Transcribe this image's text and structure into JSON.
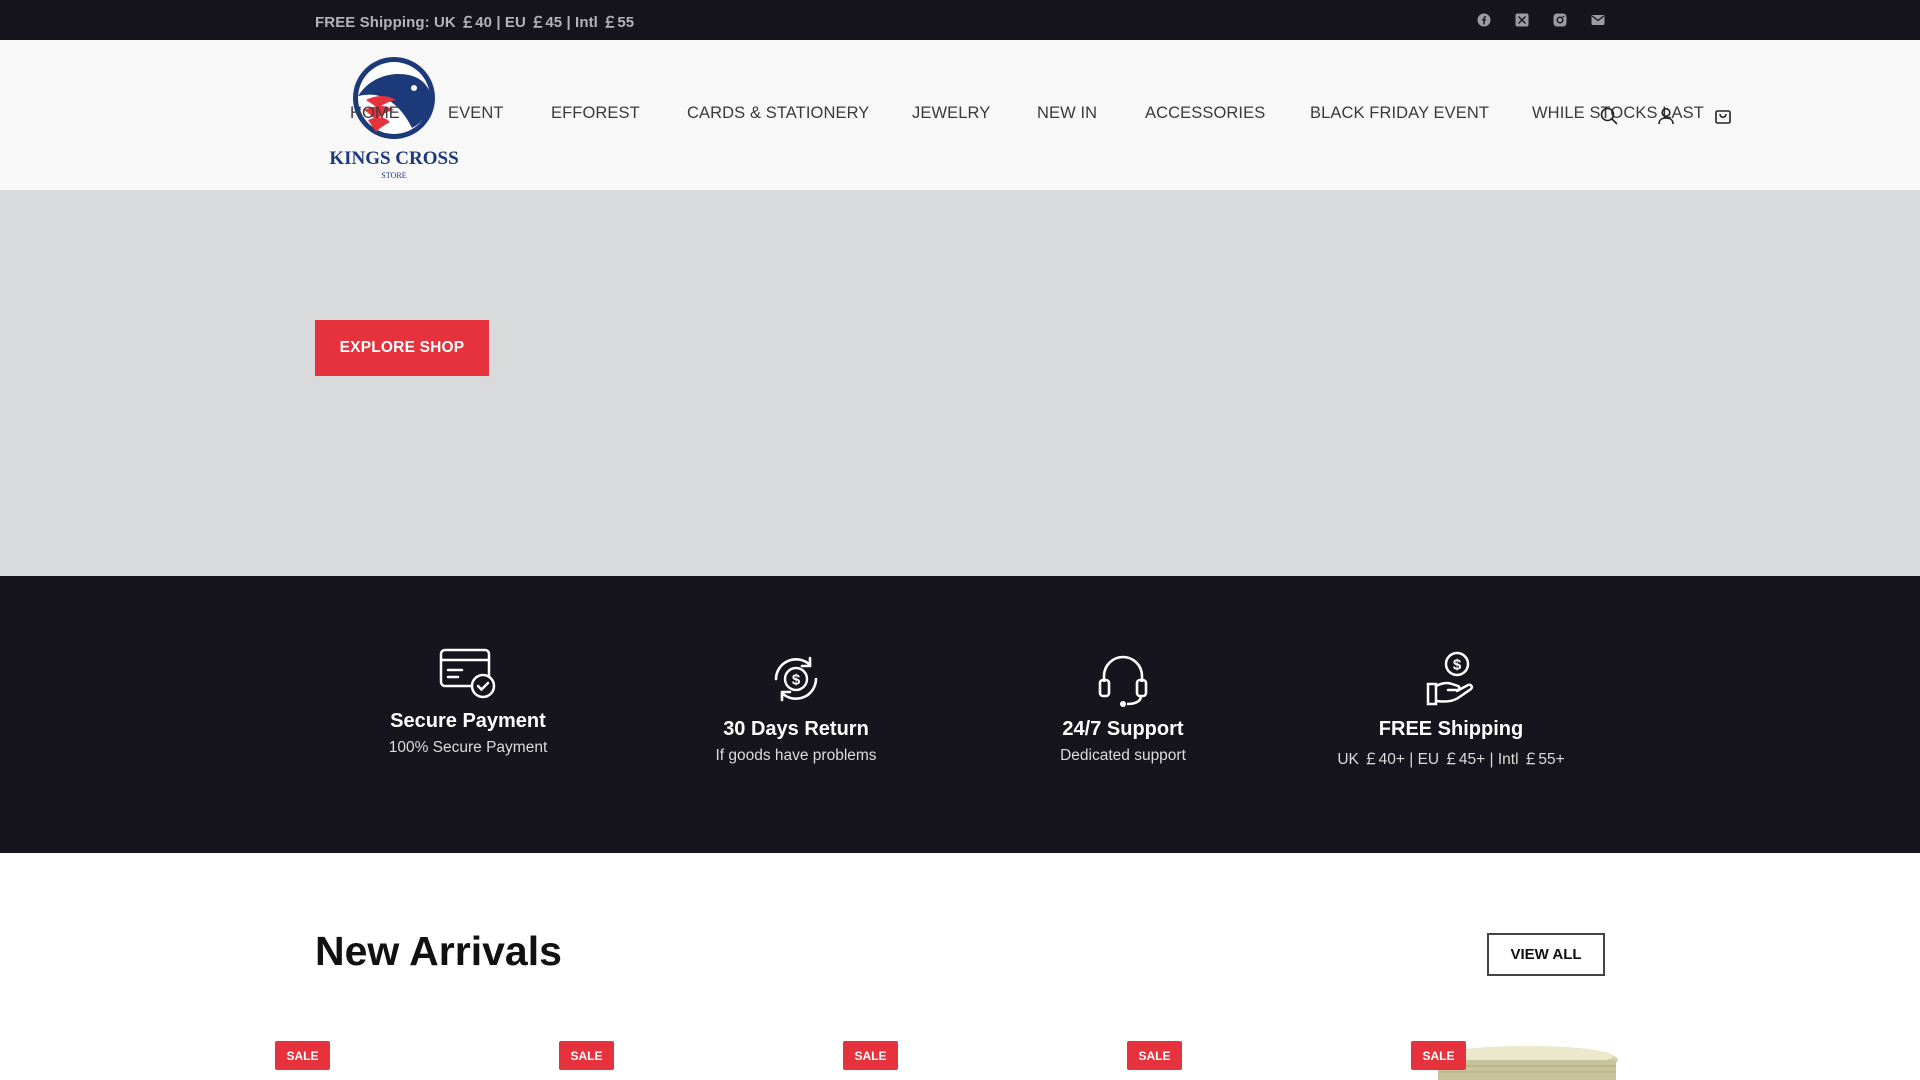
{
  "topbar": {
    "shipping_text": "FREE Shipping: UK ￡40 | EU ￡45 | Intl ￡55",
    "social_icons": [
      "facebook-icon",
      "x-icon",
      "instagram-icon",
      "email-icon"
    ]
  },
  "header": {
    "logo": {
      "name": "KINGS CROSS",
      "sub": "STORE"
    },
    "nav": [
      "HOME",
      "EVENT",
      "EFFOREST",
      "CARDS & STATIONERY",
      "JEWELRY",
      "NEW IN",
      "ACCESSORIES",
      "BLACK FRIDAY EVENT",
      "WHILE STOCKS LAST"
    ],
    "icons": [
      "search-icon",
      "user-icon",
      "cart-icon"
    ]
  },
  "hero": {
    "cta_label": "EXPLORE SHOP"
  },
  "features": [
    {
      "icon": "secure-payment-icon",
      "title": "Secure Payment",
      "subtitle": "100% Secure Payment"
    },
    {
      "icon": "return-icon",
      "title": "30 Days Return",
      "subtitle": "If goods have problems"
    },
    {
      "icon": "support-headset-icon",
      "title": "24/7 Support",
      "subtitle": "Dedicated support"
    },
    {
      "icon": "shipping-money-icon",
      "title": "FREE Shipping",
      "subtitle": "UK ￡40+ | EU ￡45+ | Intl ￡55+"
    }
  ],
  "arrivals": {
    "title": "New Arrivals",
    "view_all_label": "VIEW ALL",
    "badges": [
      "SALE",
      "SALE",
      "SALE",
      "SALE",
      "SALE"
    ]
  },
  "colors": {
    "accent": "#e5323d",
    "dark": "#16141c",
    "hero_bg": "#d9dadc"
  }
}
